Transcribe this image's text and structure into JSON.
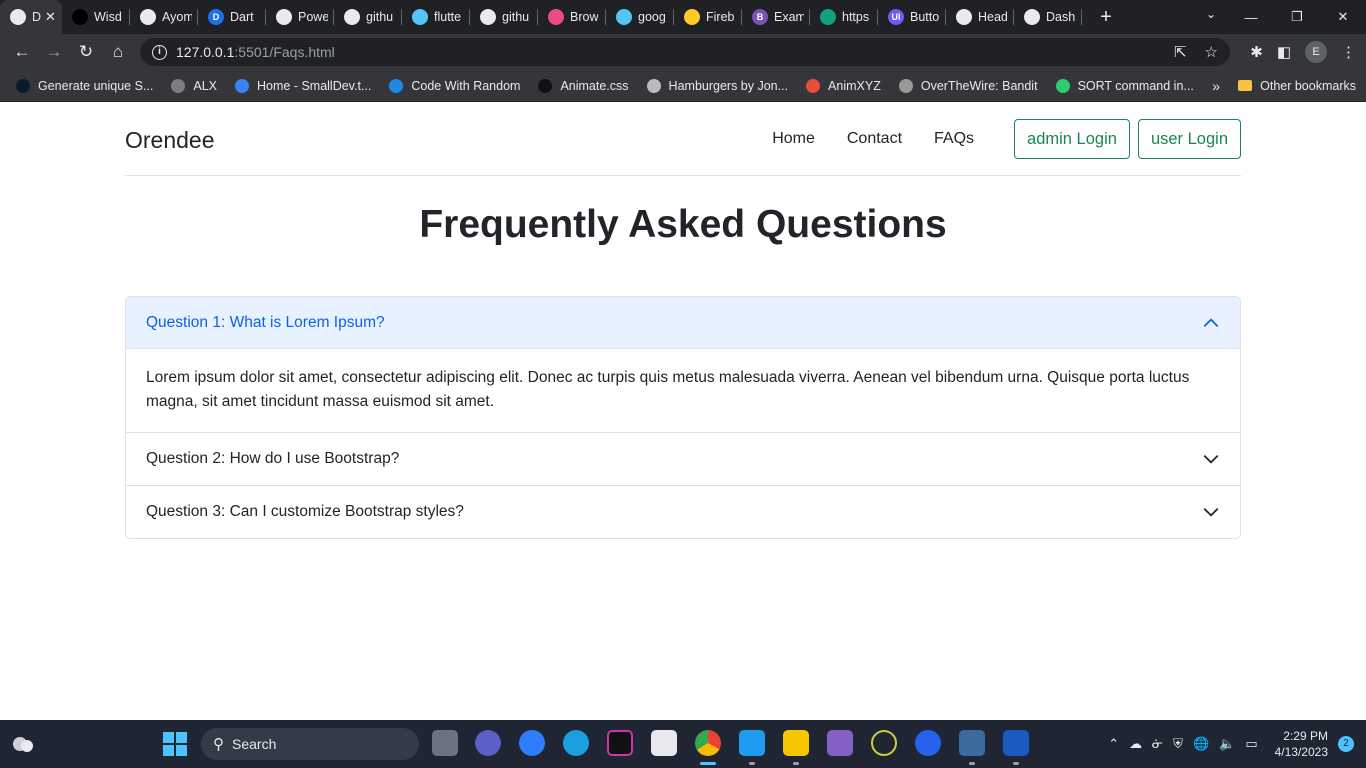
{
  "browser": {
    "tabs": [
      {
        "label": "D",
        "active": true,
        "color": "#e8eaed"
      },
      {
        "label": "Wisd",
        "color": "#000000"
      },
      {
        "label": "Ayom",
        "color": "#e8eaed"
      },
      {
        "label": "Dart",
        "color": "#1a73e8",
        "glyph": "D"
      },
      {
        "label": "Powe",
        "color": "#e8eaed"
      },
      {
        "label": "githu",
        "color": "#e8eaed"
      },
      {
        "label": "flutte",
        "color": "#54c5f8"
      },
      {
        "label": "githu",
        "color": "#e8eaed"
      },
      {
        "label": "Brow",
        "color": "#ea4c89"
      },
      {
        "label": "goog",
        "color": "#54c5f8"
      },
      {
        "label": "Fireb",
        "color": "#ffca28"
      },
      {
        "label": "Exam",
        "color": "#7952b3",
        "glyph": "B"
      },
      {
        "label": "https",
        "color": "#10a37f"
      },
      {
        "label": "Butto",
        "color": "#6f5af6",
        "glyph": "UI"
      },
      {
        "label": "Head",
        "color": "#e8eaed"
      },
      {
        "label": "Dash",
        "color": "#e8eaed"
      }
    ],
    "url_host": "127.0.0.1",
    "url_path": ":5501/Faqs.html",
    "profile_initial": "E",
    "bookmarks": [
      {
        "label": "Generate unique S...",
        "color": "#0b1b2b"
      },
      {
        "label": "ALX",
        "color": "#7d7d7d"
      },
      {
        "label": "Home - SmallDev.t...",
        "color": "#3b82f6"
      },
      {
        "label": "Code With Random",
        "color": "#1e88e5"
      },
      {
        "label": "Animate.css",
        "color": "#111111"
      },
      {
        "label": "Hamburgers by Jon...",
        "color": "#bbbbbb"
      },
      {
        "label": "AnimXYZ",
        "color": "#e74c3c"
      },
      {
        "label": "OverTheWire: Bandit",
        "color": "#999999"
      },
      {
        "label": "SORT command in...",
        "color": "#2ecc71"
      }
    ],
    "bookmarks_more": "»",
    "other_bookmarks": "Other bookmarks"
  },
  "site": {
    "brand": "Orendee",
    "nav": {
      "home": "Home",
      "contact": "Contact",
      "faqs": "FAQs",
      "admin_login": "admin Login",
      "user_login": "user Login"
    },
    "title": "Frequently Asked Questions",
    "faqs": [
      {
        "question": "Question 1: What is Lorem Ipsum?",
        "answer": "Lorem ipsum dolor sit amet, consectetur adipiscing elit. Donec ac turpis quis metus malesuada viverra. Aenean vel bibendum urna. Quisque porta luctus magna, sit amet tincidunt massa euismod sit amet.",
        "expanded": true
      },
      {
        "question": "Question 2: How do I use Bootstrap?",
        "expanded": false
      },
      {
        "question": "Question 3: Can I customize Bootstrap styles?",
        "expanded": false
      }
    ],
    "colors": {
      "accent": "#198754",
      "open_header_bg": "#e7f1ff",
      "open_header_text": "#0c63e4"
    }
  },
  "taskbar": {
    "search_placeholder": "Search",
    "time": "2:29 PM",
    "date": "4/13/2023",
    "notifications": "2"
  }
}
